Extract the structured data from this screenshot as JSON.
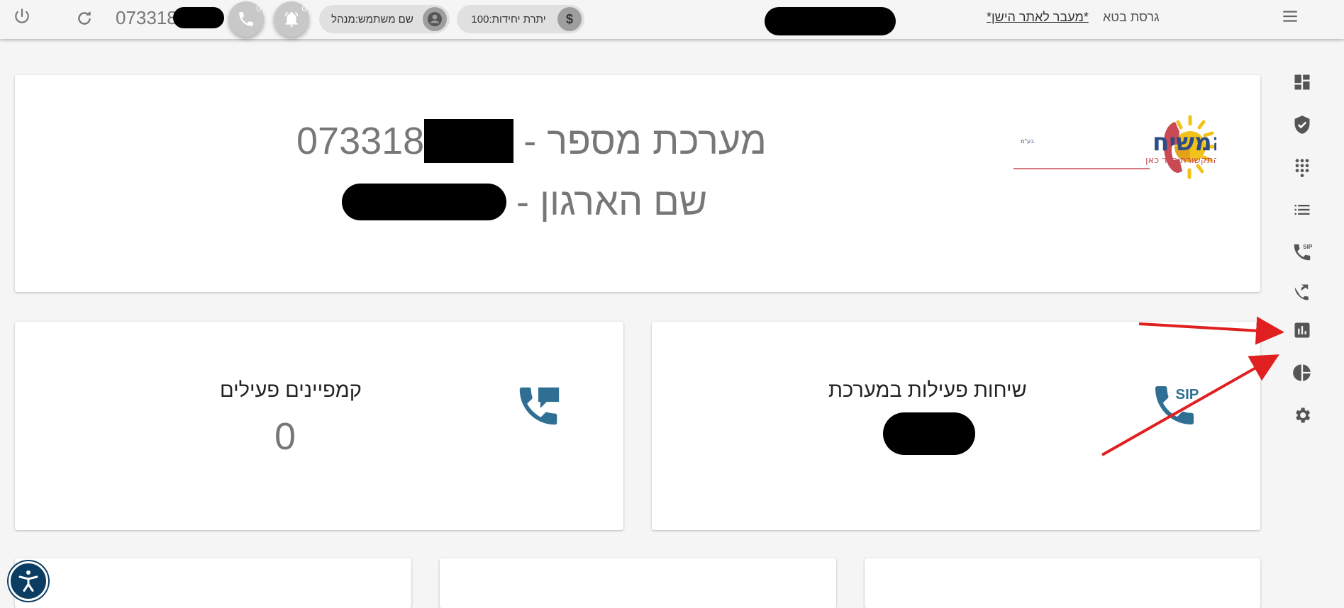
{
  "topbar": {
    "system_number_prefix": "073318",
    "calls_count": "0",
    "alerts_count": "0",
    "user_label": "שם משתמש:מנהל",
    "units_label": "יתרת יחידות:100",
    "old_site_link": "*מעבר לאתר הישן*",
    "beta_label": "גרסת בטא",
    "icons": [
      "power-icon",
      "refresh-icon",
      "phone-icon",
      "bell-icon",
      "account-circle-icon",
      "dollar-icon",
      "menu-icon"
    ]
  },
  "hero": {
    "system_line_label": "מערכת מספר -",
    "system_number_prefix": "073318",
    "org_line_label": "שם הארגון -",
    "logo": {
      "title": "ימות המשיח",
      "tagline": "עתיד התקשורת כבר כאן",
      "mark": "בע\"מ"
    }
  },
  "stats": {
    "active_calls_title": "שיחות פעילות במערכת",
    "active_campaigns_title": "קמפיינים פעילים",
    "active_campaigns_value": "0",
    "sip_label": "SIP"
  },
  "sidebar": {
    "items": [
      {
        "icon": "dashboard-icon"
      },
      {
        "icon": "shield-check-icon"
      },
      {
        "icon": "dialpad-icon"
      },
      {
        "icon": "list-icon"
      },
      {
        "icon": "sip-phone-icon",
        "label": "SIP"
      },
      {
        "icon": "phone-forward-icon"
      },
      {
        "icon": "bar-chart-icon"
      },
      {
        "icon": "pie-chart-icon"
      },
      {
        "icon": "settings-icon"
      }
    ]
  },
  "colors": {
    "icon_blue": "#2f6f93",
    "annotation_red": "#e02020",
    "a11y_navy": "#0b3d63"
  }
}
